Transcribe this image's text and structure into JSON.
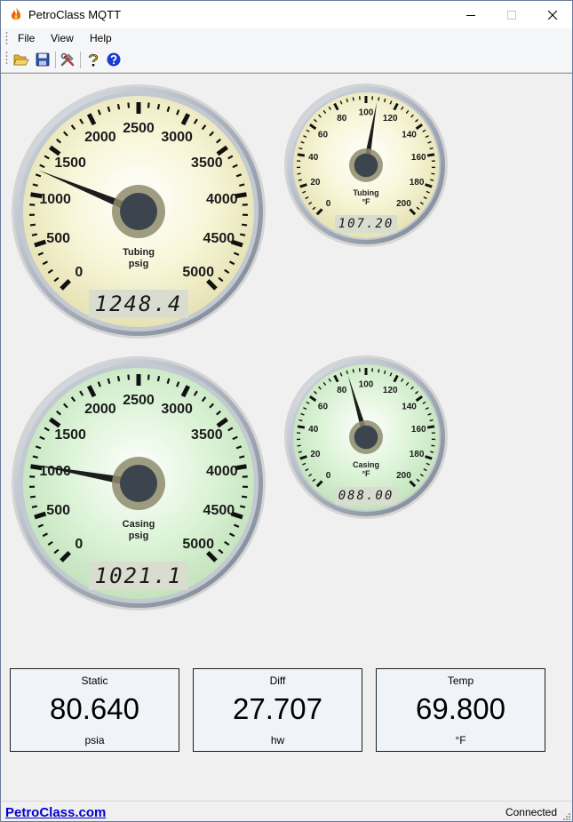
{
  "window": {
    "title": "PetroClass MQTT"
  },
  "menu": {
    "file": "File",
    "view": "View",
    "help": "Help"
  },
  "toolbar": [
    "open-icon",
    "save-icon",
    "tools-icon",
    "context-help-icon",
    "help-icon"
  ],
  "gauges": [
    {
      "id": "tubing-pressure",
      "label1": "Tubing",
      "label2": "psig",
      "min": 0,
      "max": 5000,
      "step": 500,
      "ticks": [
        "0",
        "500",
        "1000",
        "1500",
        "2000",
        "2500",
        "3000",
        "3500",
        "4000",
        "4500",
        "5000"
      ],
      "value": 1248.4,
      "readout": "1248.4",
      "face": "#f8f6d8",
      "faceEdge": "#e6e2b4"
    },
    {
      "id": "tubing-temp",
      "label1": "Tubing",
      "label2": "°F",
      "min": 0,
      "max": 200,
      "step": 20,
      "ticks": [
        "0",
        "20",
        "40",
        "60",
        "80",
        "100",
        "120",
        "140",
        "160",
        "180",
        "200"
      ],
      "value": 107.2,
      "readout": "107.20",
      "face": "#f8f6d8",
      "faceEdge": "#e6e2b4"
    },
    {
      "id": "casing-pressure",
      "label1": "Casing",
      "label2": "psig",
      "min": 0,
      "max": 5000,
      "step": 500,
      "ticks": [
        "0",
        "500",
        "1000",
        "1500",
        "2000",
        "2500",
        "3000",
        "3500",
        "4000",
        "4500",
        "5000"
      ],
      "value": 1021.1,
      "readout": "1021.1",
      "face": "#ddf4d8",
      "faceEdge": "#c3e3bd"
    },
    {
      "id": "casing-temp",
      "label1": "Casing",
      "label2": "°F",
      "min": 0,
      "max": 200,
      "step": 20,
      "ticks": [
        "0",
        "20",
        "40",
        "60",
        "80",
        "100",
        "120",
        "140",
        "160",
        "180",
        "200"
      ],
      "value": 88.0,
      "readout": "088.00",
      "face": "#ddf4d8",
      "faceEdge": "#c3e3bd"
    }
  ],
  "panels": [
    {
      "title": "Static",
      "value": "80.640",
      "unit": "psia"
    },
    {
      "title": "Diff",
      "value": "27.707",
      "unit": "hw"
    },
    {
      "title": "Temp",
      "value": "69.800",
      "unit": "°F"
    }
  ],
  "status": {
    "link": "PetroClass.com",
    "connection": "Connected"
  }
}
